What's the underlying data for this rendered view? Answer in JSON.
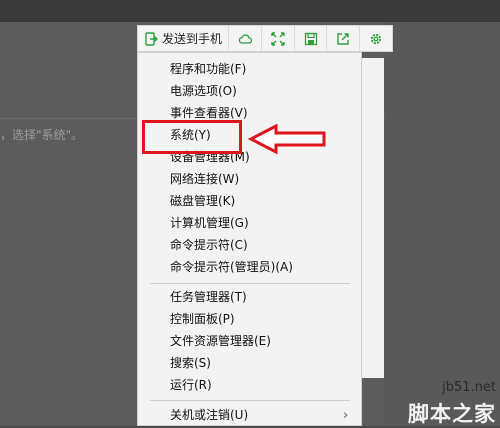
{
  "toolbar": {
    "send_label": "发送到手机",
    "icons": [
      "send-to-phone-icon",
      "cloud-icon",
      "fullscreen-icon",
      "save-icon",
      "share-icon",
      "settings-icon"
    ],
    "accent": "#2e9e3c"
  },
  "doc": {
    "text": "，选择\"系统\"。"
  },
  "menu": {
    "items": [
      "程序和功能(F)",
      "电源选项(O)",
      "事件查看器(V)",
      "系统(Y)",
      "设备管理器(M)",
      "网络连接(W)",
      "磁盘管理(K)",
      "计算机管理(G)",
      "命令提示符(C)",
      "命令提示符(管理员)(A)",
      "任务管理器(T)",
      "控制面板(P)",
      "文件资源管理器(E)",
      "搜索(S)",
      "运行(R)",
      "关机或注销(U)"
    ],
    "highlighted_item": "系统(Y)",
    "highlight_color": "#e0141f"
  },
  "watermark": {
    "line1": "jb51.net",
    "line2": "脚本之家"
  }
}
